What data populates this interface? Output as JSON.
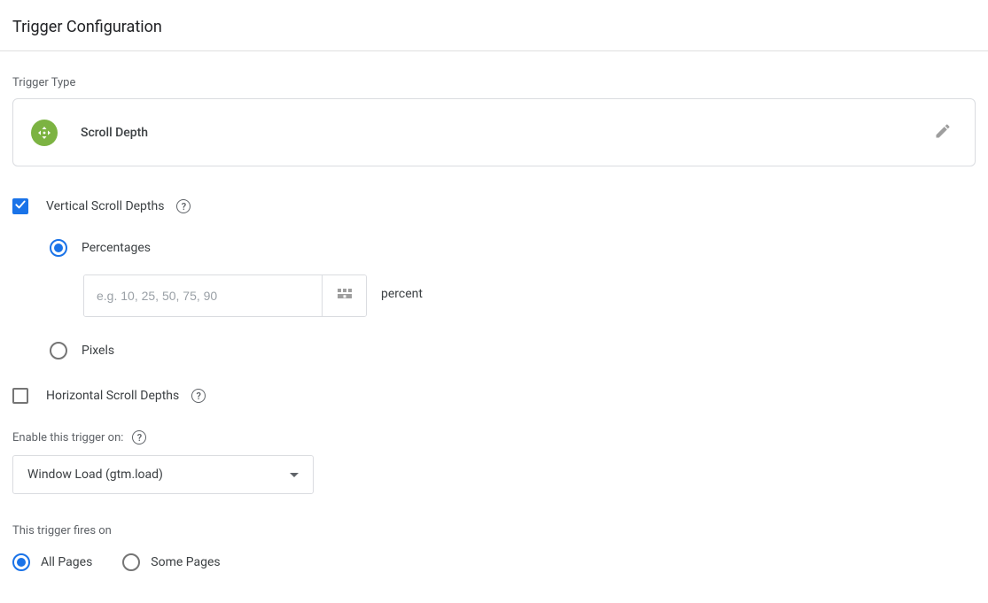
{
  "panel": {
    "title": "Trigger Configuration"
  },
  "triggerType": {
    "label": "Trigger Type",
    "name": "Scroll Depth"
  },
  "vertical": {
    "label": "Vertical Scroll Depths",
    "checked": true,
    "percentages": {
      "label": "Percentages",
      "selected": true,
      "placeholder": "e.g. 10, 25, 50, 75, 90",
      "value": "",
      "unit": "percent"
    },
    "pixels": {
      "label": "Pixels",
      "selected": false
    }
  },
  "horizontal": {
    "label": "Horizontal Scroll Depths",
    "checked": false
  },
  "enable": {
    "label": "Enable this trigger on:",
    "selected": "Window Load (gtm.load)"
  },
  "firesOn": {
    "label": "This trigger fires on",
    "allPages": {
      "label": "All Pages",
      "selected": true
    },
    "somePages": {
      "label": "Some Pages",
      "selected": false
    }
  },
  "helpGlyph": "?"
}
